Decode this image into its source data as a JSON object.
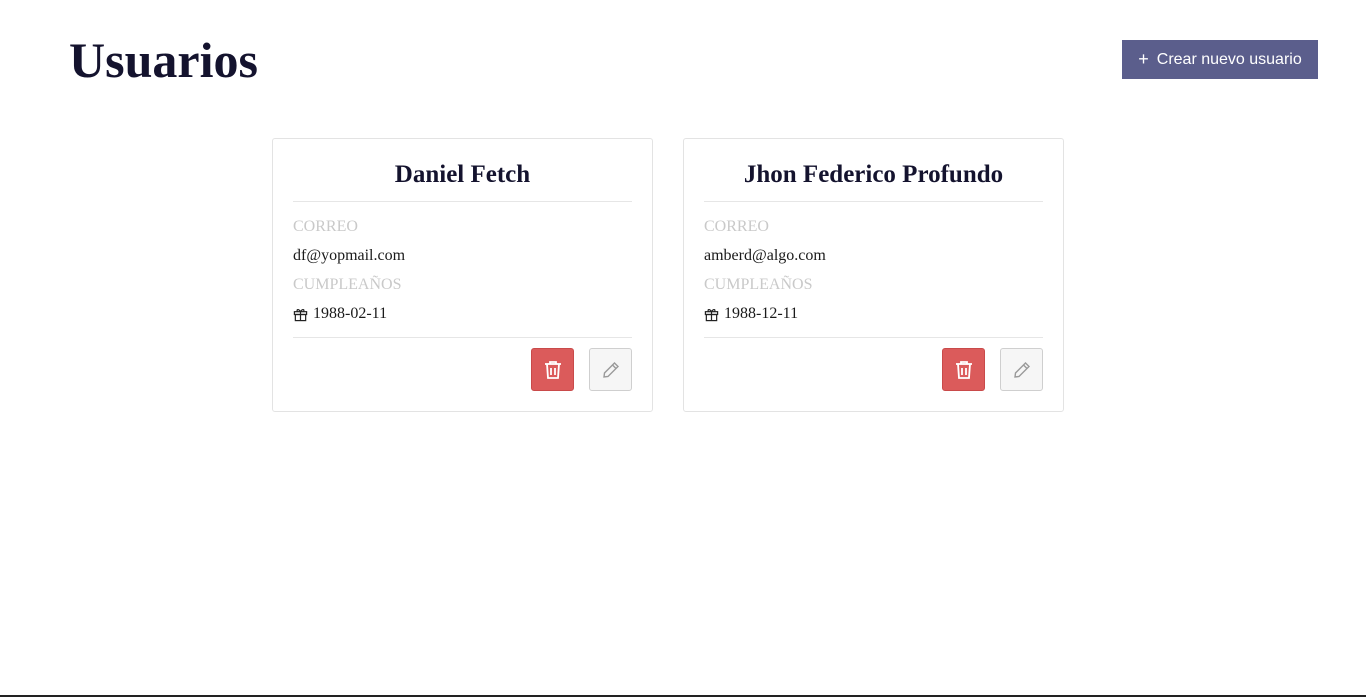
{
  "header": {
    "title": "Usuarios",
    "create_button_label": "Crear nuevo usuario",
    "create_button_icon": "plus-icon"
  },
  "users": [
    {
      "name": "Daniel Fetch",
      "email_label": "CORREO",
      "email": "df@yopmail.com",
      "birthday_label": "CUMPLEAÑOS",
      "birthday": "1988-02-11"
    },
    {
      "name": "Jhon Federico Profundo",
      "email_label": "CORREO",
      "email": "amberd@algo.com",
      "birthday_label": "CUMPLEAÑOS",
      "birthday": "1988-12-11"
    }
  ],
  "icons": {
    "birthday": "gift-icon",
    "delete": "trash-icon",
    "edit": "pencil-icon"
  },
  "colors": {
    "primary_button": "#5b5e8c",
    "delete_button": "#db5b5b",
    "title_text": "#14132e",
    "label_text": "#c9c9c9"
  }
}
